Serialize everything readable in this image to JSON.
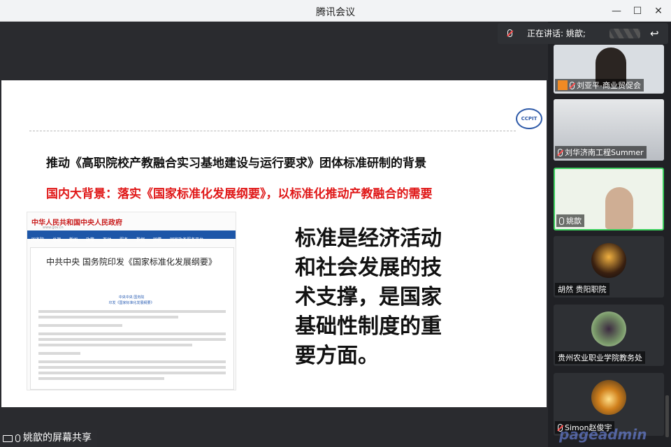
{
  "window": {
    "title": "腾讯会议"
  },
  "slide": {
    "logo_text": "CCPIT",
    "heading": "推动《高职院校产教融合实习基地建设与运行要求》团体标准研制的背景",
    "subheading": "国内大背景：落实《国家标准化发展纲要》，以标准化推动产教融合的需要",
    "big_text_lines": [
      "标准是经济活动",
      "和社会发展的技",
      "术支撑，是国家",
      "基础性制度的重",
      "要方面。"
    ],
    "doc": {
      "site_name": "中华人民共和国中央人民政府",
      "site_domain": "www.gov.cn",
      "nav": [
        "国务院",
        "总理",
        "新闻",
        "政策",
        "互动",
        "服务",
        "数据",
        "国情",
        "国家政务服务平台"
      ],
      "title": "中共中央 国务院印发《国家标准化发展纲要》",
      "source_line1": "中央中央 国务院",
      "source_line2": "印发《国家标准化发展纲要》"
    }
  },
  "share_badge": {
    "text": "姚歆的屏幕共享"
  },
  "speaking": {
    "text": "正在讲话: 姚歆;"
  },
  "participants": [
    {
      "name": "刘亚平-商业贸促会",
      "bg": "#d9dde2"
    },
    {
      "name": "刘华济南工程Summer",
      "bg": "#c8ccd2"
    },
    {
      "name": "姚歆",
      "bg": "#eef3ea"
    },
    {
      "name": "胡然 贵阳职院",
      "bg": "#2e3034"
    },
    {
      "name": "贵州农业职业学院教务处",
      "bg": "#2e3034"
    },
    {
      "name": "Simon赵俊宇",
      "bg": "#2e3034"
    }
  ],
  "watermark": "pageadmin",
  "colors": {
    "accent_red": "#e01818",
    "gov_blue": "#1d56a8"
  }
}
